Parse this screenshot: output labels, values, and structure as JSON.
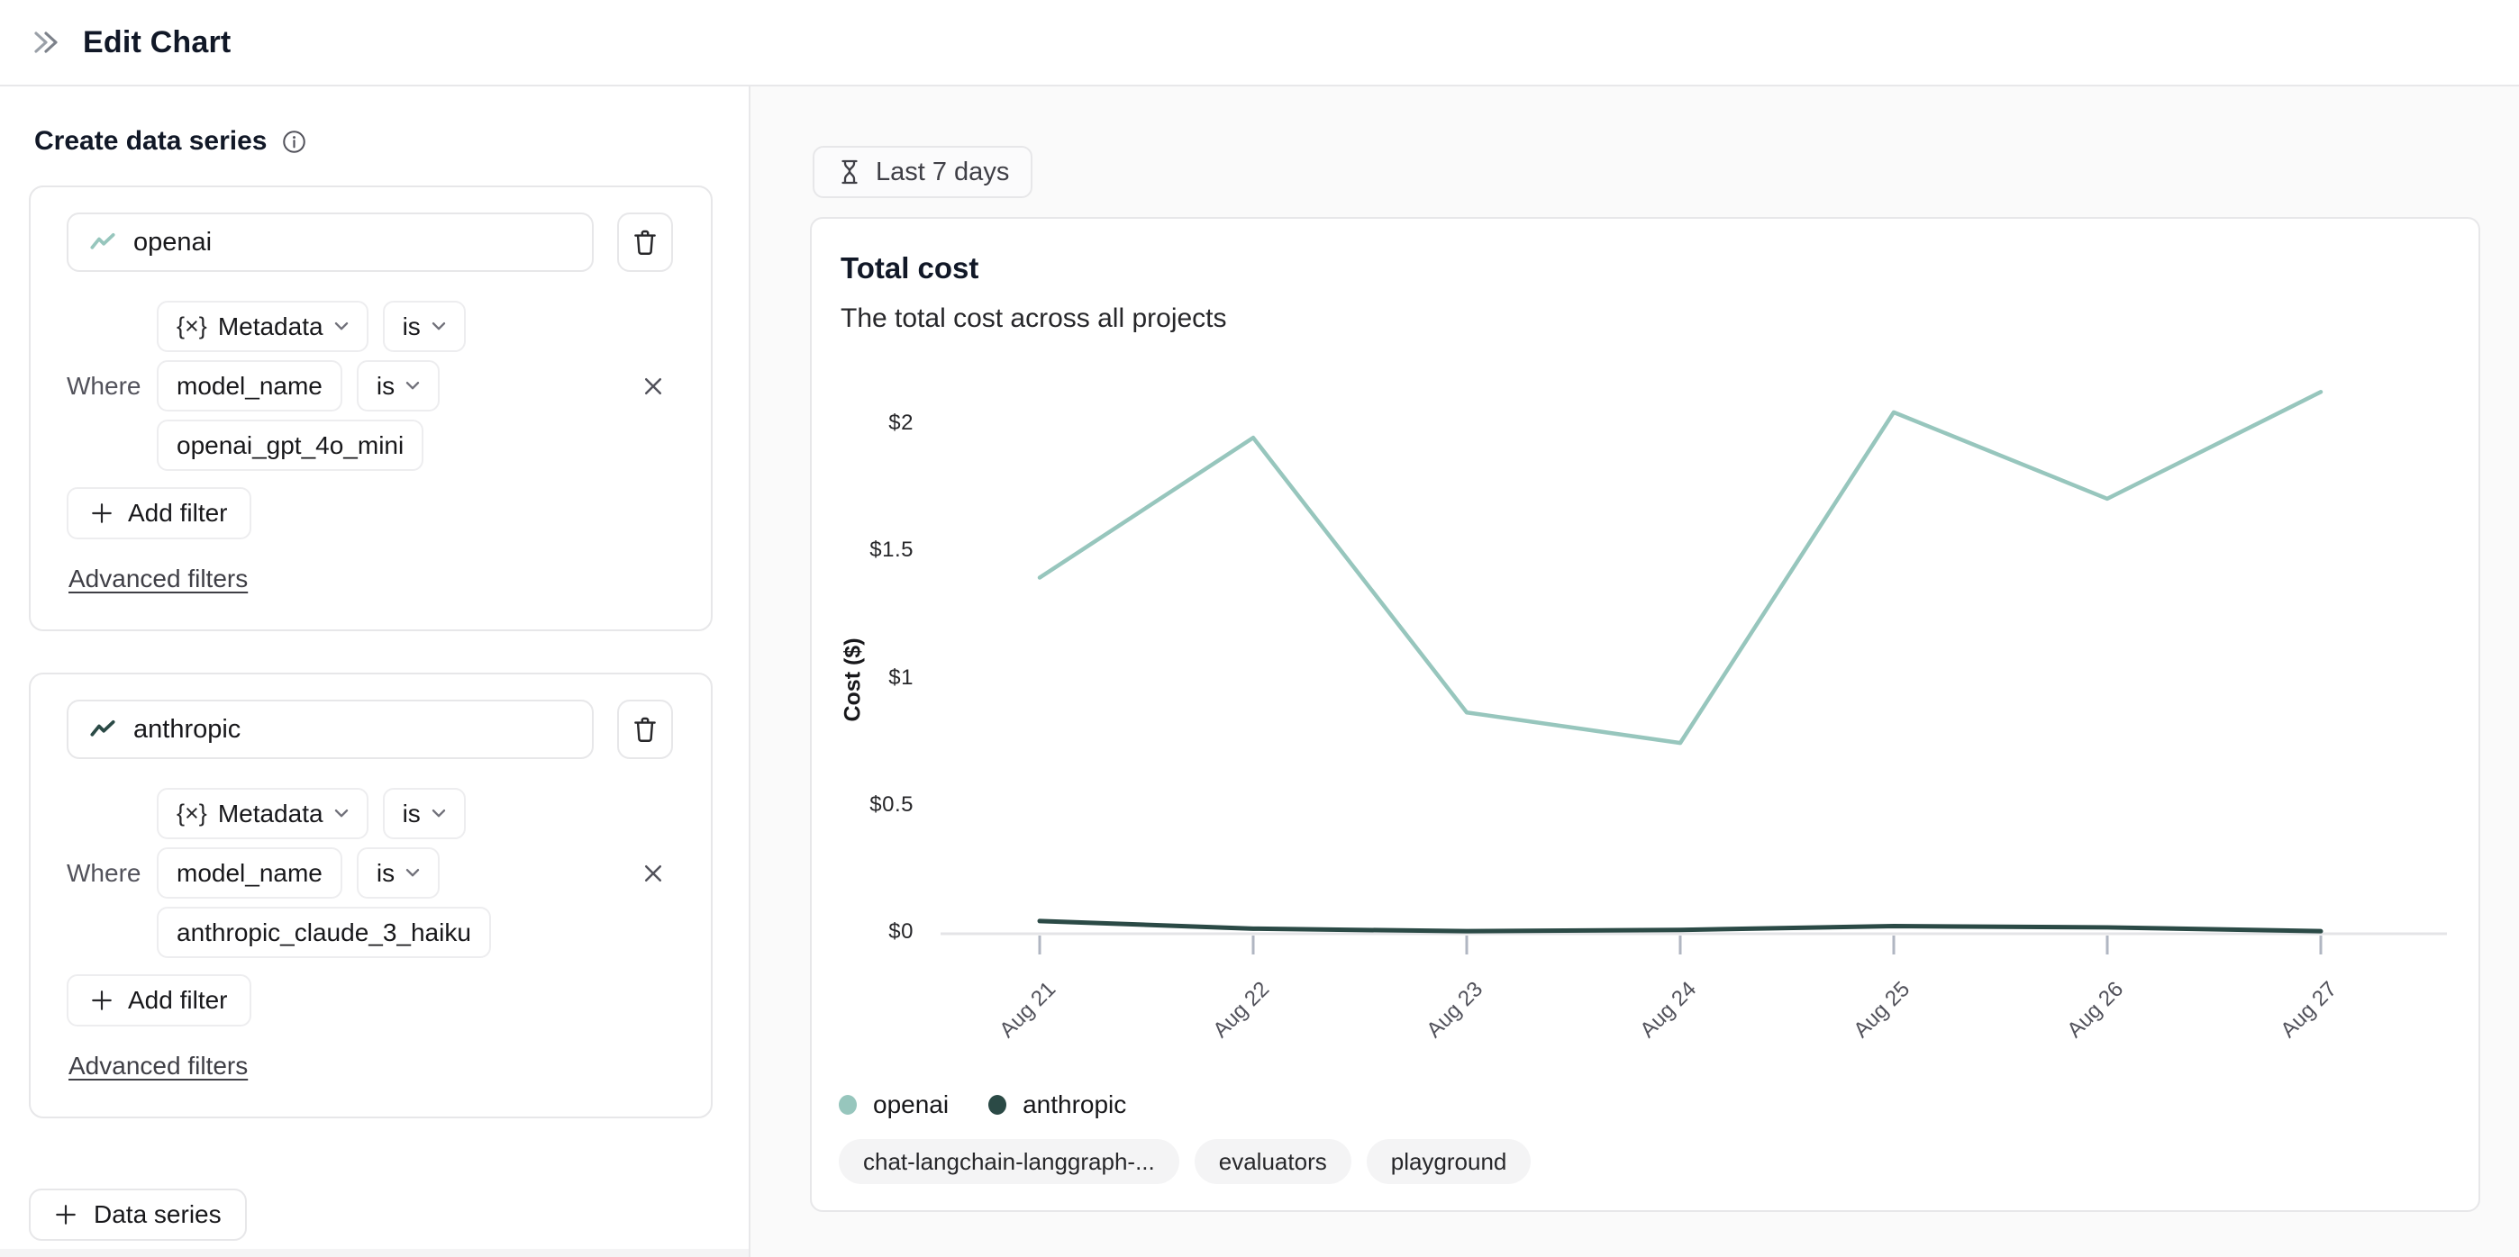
{
  "header": {
    "title": "Edit Chart"
  },
  "icons": {
    "collapse": "double-chevron-right-icon",
    "info": "info-icon",
    "series_trend": "line-chart-icon",
    "delete": "trash-icon",
    "dropdown": "chevron-down-icon",
    "remove": "close-icon",
    "add": "plus-icon",
    "time_range": "hourglass-icon"
  },
  "sidebar": {
    "heading": "Create data series",
    "cards": [
      {
        "name": "openai",
        "filter": {
          "field_prefix": "{×}",
          "field": "Metadata",
          "op": "is",
          "where_label": "Where",
          "key": "model_name",
          "key_op": "is",
          "value": "openai_gpt_4o_mini"
        },
        "add_filter_label": "Add filter",
        "advanced_filters_label": "Advanced filters"
      },
      {
        "name": "anthropic",
        "filter": {
          "field_prefix": "{×}",
          "field": "Metadata",
          "op": "is",
          "where_label": "Where",
          "key": "model_name",
          "key_op": "is",
          "value": "anthropic_claude_3_haiku"
        },
        "add_filter_label": "Add filter",
        "advanced_filters_label": "Advanced filters"
      }
    ],
    "add_series_label": "Data series"
  },
  "main": {
    "time_range_label": "Last 7 days",
    "chart_card": {
      "title": "Total cost",
      "subtitle": "The total cost across all projects",
      "tags": [
        "chat-langchain-langgraph-...",
        "evaluators",
        "playground"
      ]
    }
  },
  "chart_data": {
    "type": "line",
    "title": "Total cost",
    "subtitle": "The total cost across all projects",
    "xlabel": "",
    "ylabel": "Cost ($)",
    "x": [
      "Aug 21",
      "Aug 22",
      "Aug 23",
      "Aug 24",
      "Aug 25",
      "Aug 26",
      "Aug 27"
    ],
    "series": [
      {
        "name": "openai",
        "color": "#97c6bd",
        "values": [
          1.4,
          1.95,
          0.87,
          0.75,
          2.05,
          1.71,
          2.13
        ]
      },
      {
        "name": "anthropic",
        "color": "#2b4a46",
        "values": [
          0.05,
          0.02,
          0.01,
          0.015,
          0.03,
          0.025,
          0.01
        ]
      }
    ],
    "yticks": [
      {
        "v": 0,
        "label": "$0"
      },
      {
        "v": 0.5,
        "label": "$0.5"
      },
      {
        "v": 1,
        "label": "$1"
      },
      {
        "v": 1.5,
        "label": "$1.5"
      },
      {
        "v": 2,
        "label": "$2"
      }
    ],
    "ylim": [
      0,
      2.2
    ],
    "grid": "zero-baseline-only",
    "legend_position": "bottom-left"
  }
}
